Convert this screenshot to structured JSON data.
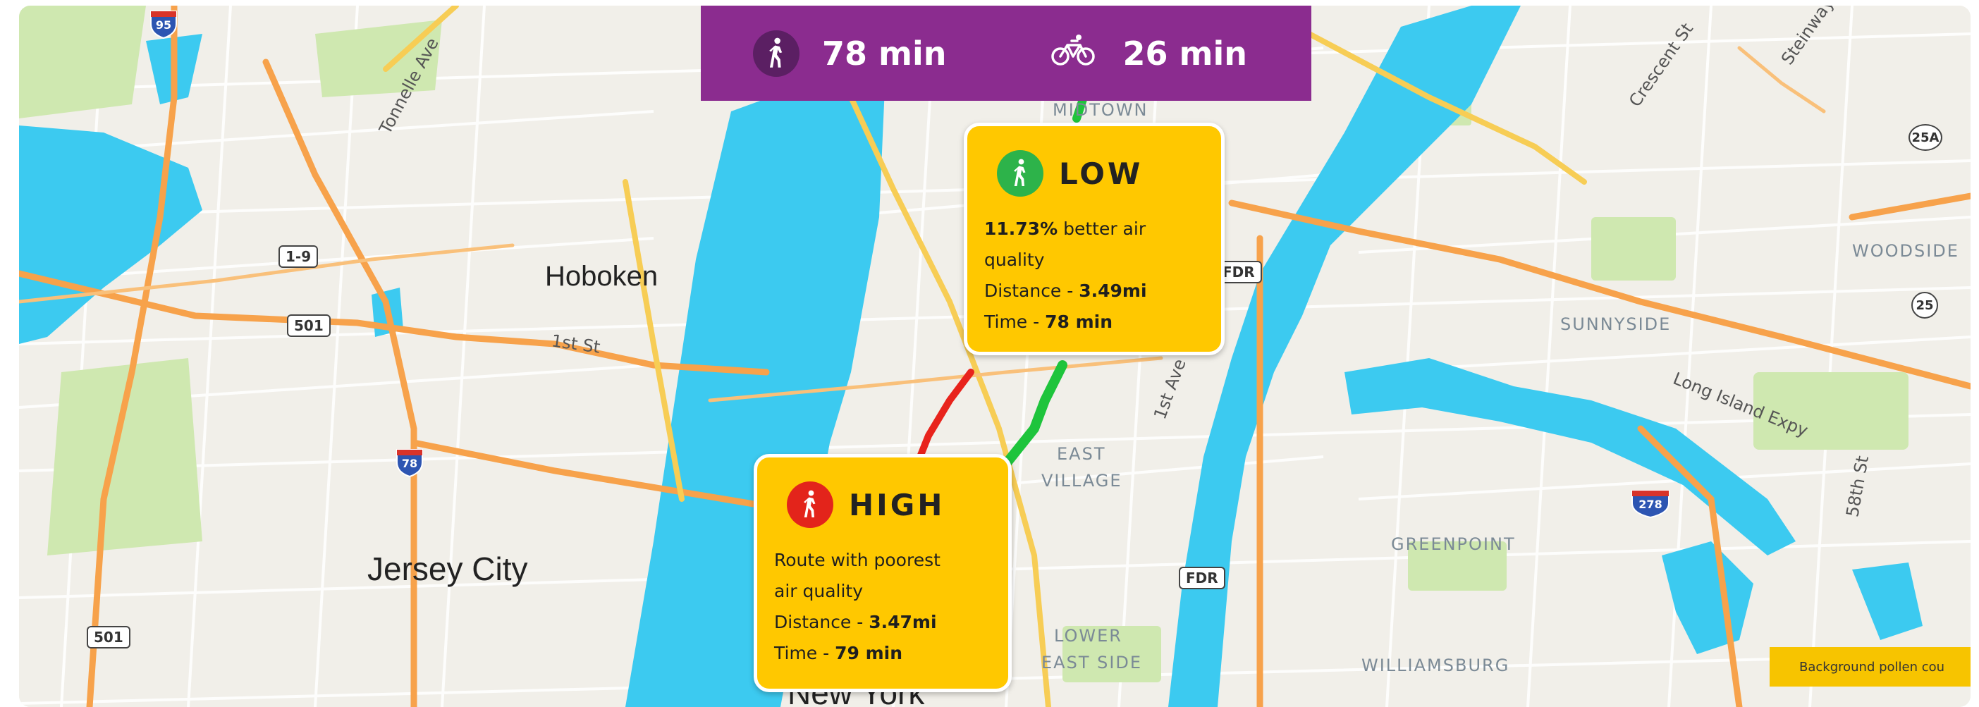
{
  "travel_modes": [
    {
      "mode": "walking",
      "icon": "walking-person-icon",
      "time": "78 min"
    },
    {
      "mode": "cycling",
      "icon": "bicycle-icon",
      "time": "26 min"
    }
  ],
  "routes": {
    "low": {
      "level": "LOW",
      "icon": "walking-person-icon",
      "badge_color": "#2db34a",
      "route_color": "#1ec43c",
      "percent": "11.73%",
      "text1": " better air",
      "text2": "quality",
      "distance_label": "Distance - ",
      "distance": "3.49mi",
      "time_label": "Time - ",
      "time": "78 min"
    },
    "high": {
      "level": "HIGH",
      "icon": "walking-person-icon",
      "badge_color": "#e3241b",
      "route_color": "#e8231c",
      "text1": "Route with poorest",
      "text2": "air quality",
      "distance_label": "Distance - ",
      "distance": "3.47mi",
      "time_label": "Time - ",
      "time": "79 min"
    }
  },
  "labels": {
    "hoboken": "Hoboken",
    "jersey_city": "Jersey City",
    "new_york": "New York",
    "first_st": "1st St",
    "tonnelle_ave": "Tonnelle Ave",
    "first_ave": "1st Ave",
    "crescent_st": "Crescent St",
    "steinway": "Steinway",
    "long_island_expy": "Long Island Expy",
    "fifty_eighth_st": "58th St",
    "midtown": "MIDTOWN",
    "east_village_1": "EAST",
    "east_village_2": "VILLAGE",
    "lower_east_side_1": "LOWER",
    "lower_east_side_2": "EAST SIDE",
    "sunnyside": "SUNNYSIDE",
    "woodside": "WOODSIDE",
    "greenpoint": "GREENPOINT",
    "williamsburg": "WILLIAMSBURG"
  },
  "shields": {
    "i95": "95",
    "i78": "78",
    "i278": "278",
    "us1_9": "1-9",
    "r501_a": "501",
    "r501_b": "501",
    "fdr_a": "FDR",
    "fdr_b": "FDR",
    "r25a": "25A",
    "r25": "25"
  },
  "legend": {
    "pollen_text": "Background pollen cou"
  },
  "colors": {
    "mode_bar": "#8b2c8f",
    "card": "#ffc800",
    "water": "#3ccaf0",
    "park": "#cfe8b0",
    "highway": "#f7a24b",
    "major_road": "#f7cd55"
  }
}
